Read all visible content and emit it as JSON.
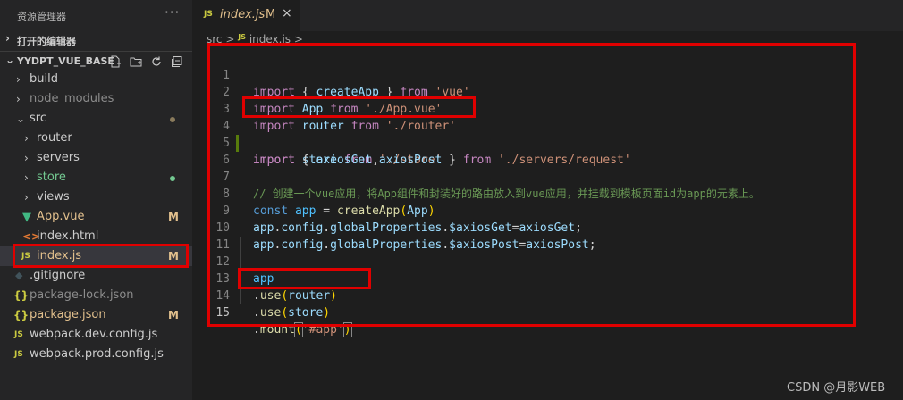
{
  "explorer": {
    "title": "资源管理器",
    "more": "···",
    "open_editors": "打开的编辑器",
    "project": "YYDPT_VUE_BASE",
    "items": [
      {
        "name": "build",
        "type": "folder",
        "status": ""
      },
      {
        "name": "node_modules",
        "type": "folder",
        "status": ""
      },
      {
        "name": "src",
        "type": "folder-open",
        "status": "dot"
      },
      {
        "name": "router",
        "type": "folder",
        "status": ""
      },
      {
        "name": "servers",
        "type": "folder",
        "status": ""
      },
      {
        "name": "store",
        "type": "folder",
        "status": "dot"
      },
      {
        "name": "views",
        "type": "folder",
        "status": ""
      },
      {
        "name": "App.vue",
        "type": "vue",
        "status": "M"
      },
      {
        "name": "index.html",
        "type": "html",
        "status": ""
      },
      {
        "name": "index.js",
        "type": "js",
        "status": "M"
      },
      {
        "name": ".gitignore",
        "type": "git",
        "status": ""
      },
      {
        "name": "package-lock.json",
        "type": "json",
        "status": ""
      },
      {
        "name": "package.json",
        "type": "json",
        "status": "M"
      },
      {
        "name": "webpack.dev.config.js",
        "type": "js",
        "status": ""
      },
      {
        "name": "webpack.prod.config.js",
        "type": "js",
        "status": ""
      }
    ]
  },
  "tab": {
    "icon": "JS",
    "name": "index.js",
    "modified": "M",
    "close": "×"
  },
  "breadcrumb": {
    "folder": "src",
    "sep": ">",
    "icon": "JS",
    "file": "index.js"
  },
  "line_numbers": [
    "1",
    "2",
    "3",
    "4",
    "5",
    "6",
    "7",
    "8",
    "9",
    "10",
    "11",
    "12",
    "13",
    "14",
    "15"
  ],
  "code": {
    "l1": {
      "import": "import",
      "ob": " { ",
      "name": "createApp",
      "cb": " } ",
      "from": "from",
      "src": " 'vue'"
    },
    "l2": {
      "import": "import",
      "name": " App ",
      "from": "from",
      "src": " './App.vue'"
    },
    "l3": {
      "import": "import",
      "name": " router ",
      "from": "from",
      "src": " './router'"
    },
    "l4": {
      "import": "import",
      "name": " store ",
      "from": "from",
      "src": " './store'"
    },
    "l5": {
      "import": "import",
      "ob": " { ",
      "n1": "axiosGet",
      "comma": ",",
      "n2": "axiosPost",
      "cb": " } ",
      "from": "from",
      "src": " './servers/request'"
    },
    "l7": {
      "comment": "// 创建一个vue应用，将App组件和封装好的路由放入到vue应用，并挂载到模板页面id为app的元素上。"
    },
    "l8": {
      "const": "const",
      "name": " app ",
      "eq": "= ",
      "fn": "createApp",
      "po": "(",
      "arg": "App",
      "pc": ")"
    },
    "l9": {
      "obj": "app",
      "d1": ".",
      "p1": "config",
      "d2": ".",
      "p2": "globalProperties",
      "d3": ".",
      "p3": "$axiosGet",
      "eq": "=",
      "val": "axiosGet",
      "semi": ";"
    },
    "l10": {
      "obj": "app",
      "d1": ".",
      "p1": "config",
      "d2": ".",
      "p2": "globalProperties",
      "d3": ".",
      "p3": "$axiosPost",
      "eq": "=",
      "val": "axiosPost",
      "semi": ";"
    },
    "l12": {
      "obj": "app"
    },
    "l13": {
      "dot": ".",
      "fn": "use",
      "po": "(",
      "arg": "router",
      "pc": ")"
    },
    "l14": {
      "dot": ".",
      "fn": "use",
      "po": "(",
      "arg": "store",
      "pc": ")"
    },
    "l15": {
      "dot": ".",
      "fn": "mount",
      "po": "(",
      "arg": "'#app'",
      "pc": ")"
    }
  },
  "watermark": "CSDN @月影WEB",
  "colors": {
    "annotation": "#e00000",
    "modified": "#e2c08d",
    "keyword": "#c586c0",
    "string": "#ce9178"
  }
}
